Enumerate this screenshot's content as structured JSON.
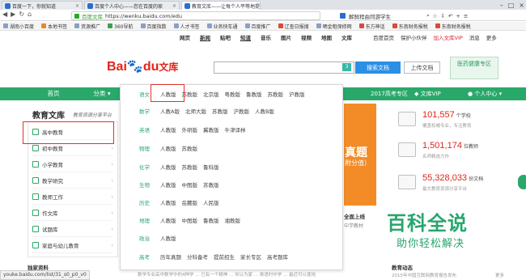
{
  "browser": {
    "tabs": [
      {
        "label": "百度一下，你就知道"
      },
      {
        "label": "百度个人中心——您在百度的家"
      },
      {
        "label": "教育文库——让每个人平等地提..."
      }
    ],
    "url_secure_label": "百度文库",
    "url": "https://wenku.baidu.com/edu",
    "addr_right": [
      "解鲜程由同游学生"
    ],
    "status_url": "youke.baidu.com/list/31_s0_p0_v0",
    "bookmarks": [
      "湖南小百度",
      "本地书签",
      "资源推广",
      "360导航",
      "百度指数",
      "人才书签",
      "业务快车通",
      "百度推广",
      "辽查日报搜",
      "晒金租保修网",
      "东方神话",
      "东南财务报税",
      "东南财务报税"
    ]
  },
  "topnav": {
    "links": [
      "网页",
      "新闻",
      "贴吧",
      "知道",
      "音乐",
      "图片",
      "视频",
      "地图",
      "文库"
    ],
    "right": [
      "百度首页",
      "保护小伙伴",
      "加入文库VIP",
      "消息",
      "更多"
    ]
  },
  "logo": {
    "text": "Bai",
    "paw": "du",
    "wenku": "文库"
  },
  "search": {
    "badge": "3",
    "search_button": "搜索文档",
    "upload_button": "上传文档",
    "promo": "医药健康专区"
  },
  "greenbar": {
    "home": "首页",
    "category": "分类",
    "exam": "2017高考专区",
    "vip": "文库VIP",
    "user": "个人中心"
  },
  "sidebar": {
    "title": "教育文库",
    "subtitle": "教育资源分享平台",
    "items": [
      {
        "label": "高中教育"
      },
      {
        "label": "初中教育"
      },
      {
        "label": "小学教育"
      },
      {
        "label": "教学研究"
      },
      {
        "label": "教师工作"
      },
      {
        "label": "作文库"
      },
      {
        "label": "试题库"
      },
      {
        "label": "家庭与幼儿教育"
      }
    ]
  },
  "panel": {
    "rows": [
      {
        "subject": "语文",
        "items": [
          "人教版",
          "苏教版",
          "北京版",
          "粤教版",
          "鲁教版",
          "苏教版",
          "沪教版"
        ]
      },
      {
        "subject": "数学",
        "items": [
          "人教A版",
          "北师大版",
          "苏教版",
          "沪教版",
          "人教B版"
        ]
      },
      {
        "subject": "英语",
        "items": [
          "人教版",
          "外研版",
          "冀教版",
          "牛津译林"
        ]
      },
      {
        "subject": "物理",
        "items": [
          "人教版",
          "苏教版"
        ]
      },
      {
        "subject": "化学",
        "items": [
          "人教版",
          "苏教版",
          "鲁科版"
        ]
      },
      {
        "subject": "生物",
        "items": [
          "人教版",
          "中图版",
          "苏教版"
        ]
      },
      {
        "subject": "历史",
        "items": [
          "人教版",
          "岳麓版",
          "人民版"
        ]
      },
      {
        "subject": "地理",
        "items": [
          "人教版",
          "中图版",
          "鲁教版",
          "湘教版"
        ]
      },
      {
        "subject": "政治",
        "items": [
          "人教版"
        ]
      },
      {
        "subject": "高考",
        "items": [
          "历年真题",
          "分科备考",
          "提前招生",
          "家长专区",
          "高考题库"
        ]
      }
    ]
  },
  "middle": {
    "banner_big": "真题",
    "banner_small": "附分值）",
    "card_title": "全面上线",
    "card_sub": "中学教材"
  },
  "stats": [
    {
      "num": "101,557",
      "unit": "个学校",
      "desc": "覆盖权威专业，专注教育"
    },
    {
      "num": "1,501,174",
      "unit": "位教师",
      "desc": "名师精选力作"
    },
    {
      "num": "55,328,033",
      "unit": "份文档",
      "desc": "最大教育资源分享平台"
    }
  ],
  "watermark": {
    "line1": "百科全说",
    "line2": "助你轻松解决"
  },
  "bottom": {
    "left": "独家资料",
    "mid": "数学专业高中数学中的4种学 ... 已有一个精神 ... 何以为家 ... 奥语时中学 ... 最近可以使用",
    "right": "教育动态",
    "right2": "2015年中国互联网教育报告发布",
    "right3": "更多"
  }
}
